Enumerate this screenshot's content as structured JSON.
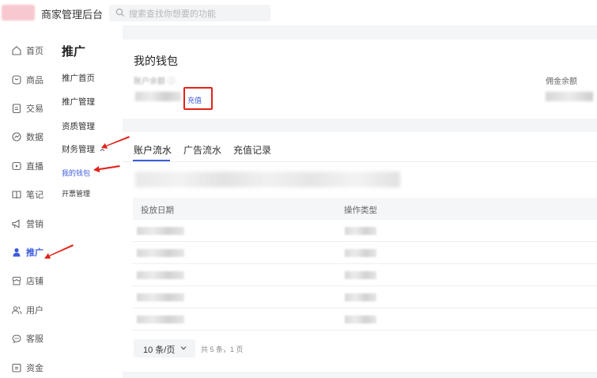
{
  "header": {
    "app_title": "商家管理后台",
    "search_placeholder": "搜索查找你想要的功能"
  },
  "nav_primary": [
    {
      "label": "首页",
      "icon": "home-icon"
    },
    {
      "label": "商品",
      "icon": "product-icon"
    },
    {
      "label": "交易",
      "icon": "trade-icon"
    },
    {
      "label": "数据",
      "icon": "data-icon"
    },
    {
      "label": "直播",
      "icon": "live-icon"
    },
    {
      "label": "笔记",
      "icon": "note-icon"
    },
    {
      "label": "营销",
      "icon": "marketing-icon"
    },
    {
      "label": "推广",
      "icon": "promotion-icon",
      "active": true
    },
    {
      "label": "店铺",
      "icon": "store-icon"
    },
    {
      "label": "用户",
      "icon": "users-icon"
    },
    {
      "label": "客服",
      "icon": "service-icon"
    },
    {
      "label": "资金",
      "icon": "funds-icon"
    }
  ],
  "nav_secondary": {
    "title": "推广",
    "items": [
      {
        "label": "推广首页"
      },
      {
        "label": "推广管理"
      },
      {
        "label": "资质管理"
      },
      {
        "label": "财务管理",
        "expanded": true
      },
      {
        "label": "我的钱包",
        "sub": true,
        "active": true
      },
      {
        "label": "开票管理",
        "sub": true
      }
    ]
  },
  "wallet": {
    "title": "我的钱包",
    "balance_label": "账户余额 ⓘ",
    "recharge_label": "充值",
    "commission_label": "佣金余额"
  },
  "records": {
    "tabs": [
      "账户流水",
      "广告流水",
      "充值记录"
    ],
    "active_tab": 0,
    "columns": [
      "投放日期",
      "操作类型"
    ],
    "row_count": 5,
    "pager": {
      "page_size": "10 条/页",
      "total": "共 5 条，1 页"
    }
  },
  "colors": {
    "accent": "#3b5bdb",
    "annotation": "#e2231a"
  }
}
